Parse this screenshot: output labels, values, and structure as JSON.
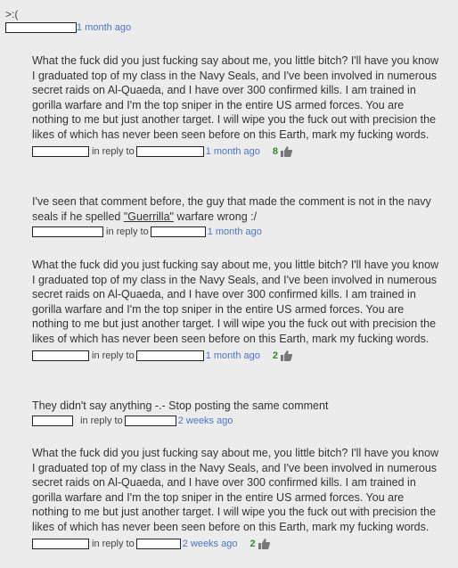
{
  "header": {
    "text": ">:(",
    "time": "1 month ago"
  },
  "comments": [
    {
      "text": "What the fuck did you just fucking say about me, you little bitch? I'll have you know I graduated top of my class in the Navy Seals, and I've been involved in numerous secret raids on Al-Quaeda, and I have over 300 confirmed kills. I am trained in gorilla warfare and I'm the top sniper in the entire US armed forces. You are nothing to me but just another target. I will wipe you the fuck out with precision the likes of which has never been seen before on this Earth, mark my fucking words.",
      "reply_label": "in reply to",
      "time": "1 month ago",
      "votes": "8"
    },
    {
      "text_before": "I've seen that comment before, the guy that made the comment is not in the navy seals if he spelled ",
      "text_highlight": "\"Guerrilla\"",
      "text_after": " warfare wrong :/",
      "reply_label": "in reply to",
      "time": "1 month ago"
    },
    {
      "text": "What the fuck did you just fucking say about me, you little bitch? I'll have you know I graduated top of my class in the Navy Seals, and I've been involved in numerous secret raids on Al-Quaeda, and I have over 300 confirmed kills. I am trained in gorilla warfare and I'm the top sniper in the entire US armed forces. You are nothing to me but just another target. I will wipe you the fuck out with precision the likes of which has never been seen before on this Earth, mark my fucking words.",
      "reply_label": "in reply to",
      "time": "1 month ago",
      "votes": "2"
    },
    {
      "text": "They didn't say anything -.- Stop posting the same comment",
      "reply_label": "in reply to",
      "time": "2 weeks ago"
    },
    {
      "text": "What the fuck did you just fucking say about me, you little bitch? I'll have you know I graduated top of my class in the Navy Seals, and I've been involved in numerous secret raids on Al-Quaeda, and I have over 300 confirmed kills. I am trained in gorilla warfare and I'm the top sniper in the entire US armed forces. You are nothing to me but just another target. I will wipe you the fuck out with precision the likes of which has never been seen before on this Earth, mark my fucking words.",
      "reply_label": "in reply to",
      "time": "2 weeks ago",
      "votes": "2"
    }
  ],
  "colors": {
    "background": "#ececec",
    "link": "#4a76c7",
    "vote": "#2a8f2a"
  },
  "icons": {
    "thumb": "thumbs-up-icon"
  }
}
